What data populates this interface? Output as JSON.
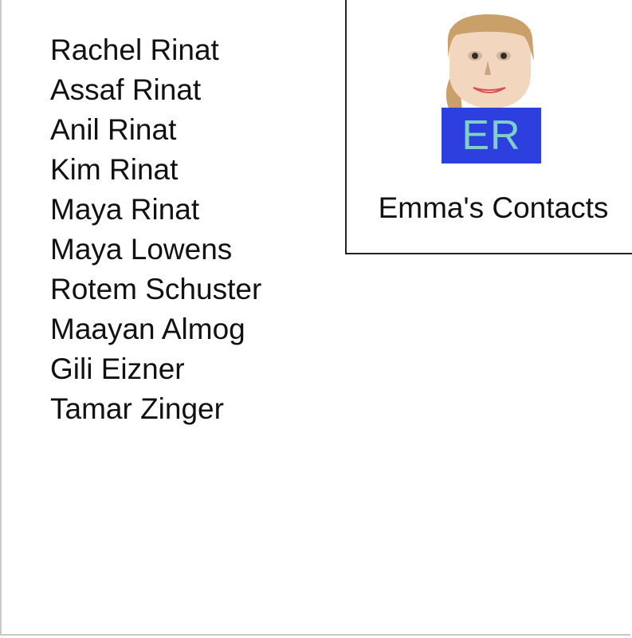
{
  "contacts": [
    "Rachel Rinat",
    "Assaf Rinat",
    "Anil Rinat",
    "Kim Rinat",
    "Maya Rinat",
    "Maya Lowens",
    "Rotem Schuster",
    "Maayan Almog",
    "Gili Eizner",
    "Tamar Zinger"
  ],
  "profile": {
    "initials": "ER",
    "title": "Emma's Contacts",
    "avatar_icon": "person-avatar-icon",
    "colors": {
      "initials_background": "#2e3fe0",
      "initials_text": "#7fd0c8",
      "skin": "#f2d2b6",
      "hair": "#c9a06a"
    }
  }
}
